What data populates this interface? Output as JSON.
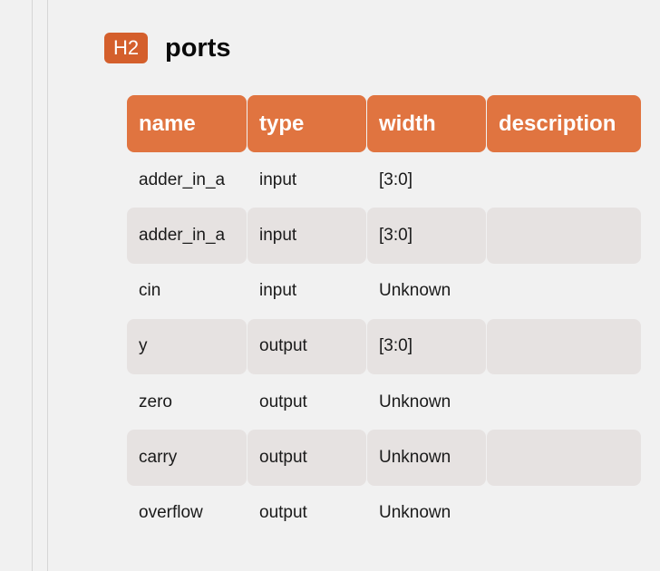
{
  "section": {
    "badge": "H2",
    "title": "ports"
  },
  "table": {
    "headers": [
      "name",
      "type",
      "width",
      "description"
    ],
    "rows": [
      [
        "adder_in_a",
        "input",
        "[3:0]",
        ""
      ],
      [
        "adder_in_a",
        "input",
        "[3:0]",
        ""
      ],
      [
        "cin",
        "input",
        "Unknown",
        ""
      ],
      [
        "y",
        "output",
        "[3:0]",
        ""
      ],
      [
        "zero",
        "output",
        "Unknown",
        ""
      ],
      [
        "carry",
        "output",
        "Unknown",
        ""
      ],
      [
        "overflow",
        "output",
        "Unknown",
        ""
      ]
    ]
  },
  "colors": {
    "badge_bg": "#d45f2c",
    "header_bg": "#e07440",
    "stripe_bg": "#e6e2e1",
    "page_bg": "#f1f1f1"
  }
}
